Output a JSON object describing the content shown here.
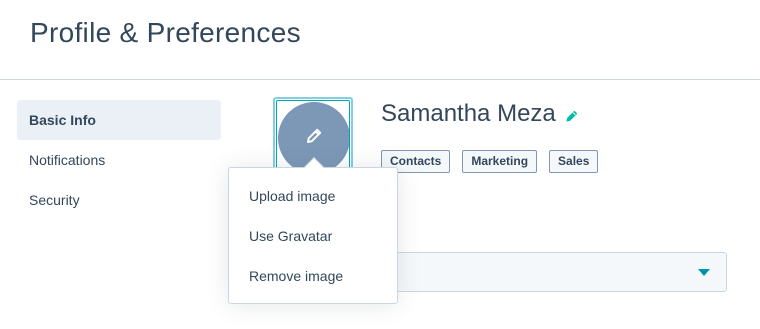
{
  "header": {
    "title": "Profile & Preferences"
  },
  "sidebar": {
    "items": [
      {
        "label": "Basic Info",
        "active": true
      },
      {
        "label": "Notifications",
        "active": false
      },
      {
        "label": "Security",
        "active": false
      }
    ]
  },
  "profile": {
    "name": "Samantha Meza",
    "tags": [
      "Contacts",
      "Marketing",
      "Sales"
    ],
    "avatar_icon": "pencil-icon",
    "name_edit_icon": "pencil-icon"
  },
  "avatar_menu": {
    "items": [
      "Upload image",
      "Use Gravatar",
      "Remove image"
    ]
  },
  "select": {
    "value": "",
    "icon": "caret-down-icon"
  },
  "colors": {
    "text": "#33475b",
    "avatar_bg": "#7c98b6",
    "accent": "#00a4bd",
    "edit_icon": "#00bda5",
    "active_nav_bg": "#eaf0f6",
    "border": "#cbd6e2"
  }
}
